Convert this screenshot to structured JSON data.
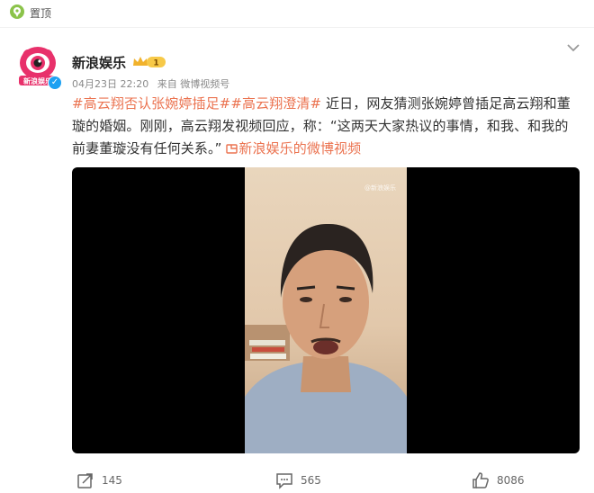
{
  "pin": {
    "label": "置顶",
    "icon": "pin-location-icon"
  },
  "post": {
    "author": "新浪娱乐",
    "avatar_text": "新浪娱乐",
    "badge_text": "1",
    "date": "04月23日 22:20",
    "source": "来自 微博视频号",
    "tags": [
      "#高云翔否认张婉婷插足#",
      "#高云翔澄清#"
    ],
    "body": " 近日，网友猜测张婉婷曾插足高云翔和董璇的婚姻。刚刚，高云翔发视频回应，称：“这两天大家热议的事情，和我、和我的前妻董璇没有任何关系。”",
    "video_link": "新浪娱乐的微博视频",
    "video_link_icon": "video-link-icon",
    "video_watermark": "@新浪娱乐"
  },
  "actions": {
    "repost": {
      "count": "145",
      "icon": "share-icon"
    },
    "comment": {
      "count": "565",
      "icon": "comment-icon"
    },
    "like": {
      "count": "8086",
      "icon": "thumbs-up-icon"
    }
  },
  "colors": {
    "link": "#eb7350",
    "accent": "#f1b22c",
    "background": "#ffffff"
  }
}
